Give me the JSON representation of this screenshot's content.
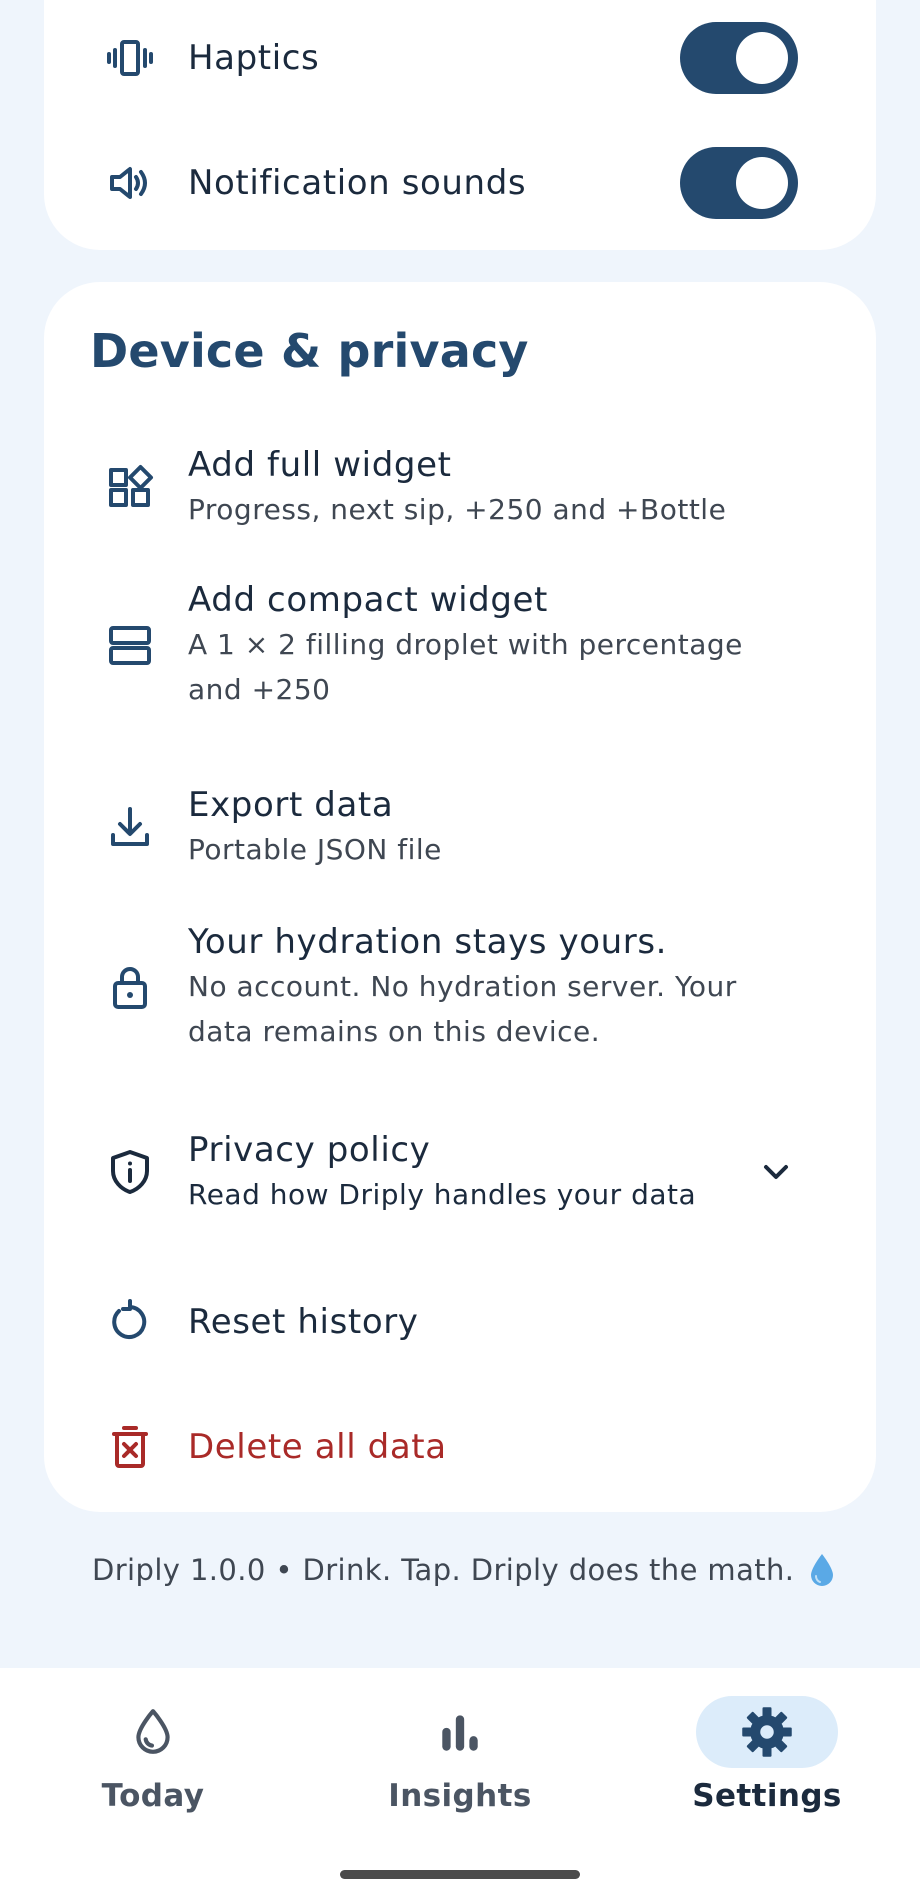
{
  "preferences": {
    "haptics_label": "Haptics",
    "notification_sounds_label": "Notification sounds"
  },
  "device_privacy": {
    "section_title": "Device & privacy",
    "items": [
      {
        "title": "Add full widget",
        "subtitle": "Progress, next sip, +250 and +Bottle"
      },
      {
        "title": "Add compact widget",
        "subtitle": "A 1 × 2 filling droplet with percentage and +250"
      },
      {
        "title": "Export data",
        "subtitle": "Portable JSON file"
      },
      {
        "title": "Your hydration stays yours.",
        "subtitle": "No account. No hydration server. Your data remains on this device."
      },
      {
        "title": "Privacy policy",
        "subtitle": "Read how Driply handles your data"
      },
      {
        "title": "Reset history"
      },
      {
        "title": "Delete all data"
      }
    ]
  },
  "footer": {
    "note": "Driply 1.0.0 • Drink. Tap. Driply does the math."
  },
  "nav": {
    "today": "Today",
    "insights": "Insights",
    "settings": "Settings"
  },
  "colors": {
    "accent": "#24496e",
    "danger": "#a92a28",
    "background": "#eff5fc",
    "active_nav_pill": "#dcecfa"
  }
}
